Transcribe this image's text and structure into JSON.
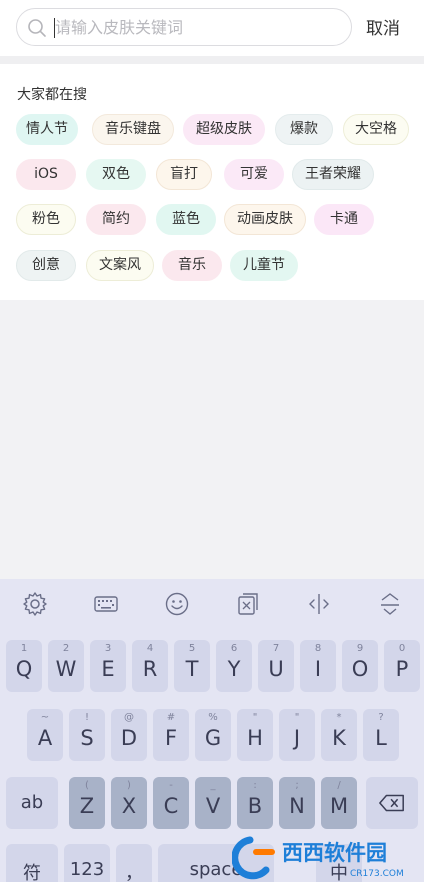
{
  "search": {
    "placeholder": "请输入皮肤关键词",
    "cancel_label": "取消"
  },
  "hot": {
    "title": "大家都在搜",
    "tags": [
      {
        "label": "情人节",
        "bg": "#dff6f2",
        "border": "#dff6f2"
      },
      {
        "label": "音乐键盘",
        "bg": "#fbf6ee",
        "border": "#f3e9dc"
      },
      {
        "label": "超级皮肤",
        "bg": "#fbe9f6",
        "border": "#fbe9f6"
      },
      {
        "label": "爆款",
        "bg": "#eef3f4",
        "border": "#e4eced"
      },
      {
        "label": "大空格",
        "bg": "#fcfcf2",
        "border": "#eeeed8"
      },
      {
        "label": "iOS",
        "bg": "#fbe8ee",
        "border": "#fbe8ee"
      },
      {
        "label": "双色",
        "bg": "#e6f8f2",
        "border": "#e6f8f2"
      },
      {
        "label": "盲打",
        "bg": "#fdf6ec",
        "border": "#f3e6d6"
      },
      {
        "label": "可爱",
        "bg": "#fbe9f7",
        "border": "#fbe9f7"
      },
      {
        "label": "王者荣耀",
        "bg": "#ecf2f3",
        "border": "#e1eaeb"
      },
      {
        "label": "粉色",
        "bg": "#fcfcf1",
        "border": "#ededd7"
      },
      {
        "label": "简约",
        "bg": "#fbe8ee",
        "border": "#fbe8ee"
      },
      {
        "label": "蓝色",
        "bg": "#e1f7f1",
        "border": "#e1f7f1"
      },
      {
        "label": "动画皮肤",
        "bg": "#fdf6ec",
        "border": "#f3e6d6"
      },
      {
        "label": "卡通",
        "bg": "#fbe7f7",
        "border": "#fbe7f7"
      },
      {
        "label": "创意",
        "bg": "#eef3f3",
        "border": "#e2eaea"
      },
      {
        "label": "文案风",
        "bg": "#fcfcf1",
        "border": "#ededd7"
      },
      {
        "label": "音乐",
        "bg": "#fbe8ee",
        "border": "#fbe8ee"
      },
      {
        "label": "儿童节",
        "bg": "#e3f7f1",
        "border": "#e3f7f1"
      }
    ]
  },
  "keyboard": {
    "toolbar": [
      "gear-icon",
      "keyboard-icon",
      "emoji-icon",
      "clipboard-icon",
      "cursor-icon",
      "hide-keyboard-icon"
    ],
    "row1": [
      {
        "k": "Q",
        "h": "1"
      },
      {
        "k": "W",
        "h": "2"
      },
      {
        "k": "E",
        "h": "3"
      },
      {
        "k": "R",
        "h": "4"
      },
      {
        "k": "T",
        "h": "5"
      },
      {
        "k": "Y",
        "h": "6"
      },
      {
        "k": "U",
        "h": "7"
      },
      {
        "k": "I",
        "h": "8"
      },
      {
        "k": "O",
        "h": "9"
      },
      {
        "k": "P",
        "h": "0"
      }
    ],
    "row2": [
      {
        "k": "A",
        "h": "~"
      },
      {
        "k": "S",
        "h": "!"
      },
      {
        "k": "D",
        "h": "@"
      },
      {
        "k": "F",
        "h": "#"
      },
      {
        "k": "G",
        "h": "%"
      },
      {
        "k": "H",
        "h": "\""
      },
      {
        "k": "J",
        "h": "\""
      },
      {
        "k": "K",
        "h": "*"
      },
      {
        "k": "L",
        "h": "?"
      }
    ],
    "row3": [
      {
        "k": "Z",
        "h": "("
      },
      {
        "k": "X",
        "h": ")"
      },
      {
        "k": "C",
        "h": "-"
      },
      {
        "k": "V",
        "h": "_"
      },
      {
        "k": "B",
        "h": ":"
      },
      {
        "k": "N",
        "h": ";"
      },
      {
        "k": "M",
        "h": "/"
      }
    ],
    "ab_label": "ab",
    "fu_label": "符",
    "num_label": "123",
    "comma_label": "，",
    "space_label": "space",
    "zh_label": "中"
  },
  "watermark": {
    "text": "西西软件园",
    "sub": "CR173.COM"
  }
}
